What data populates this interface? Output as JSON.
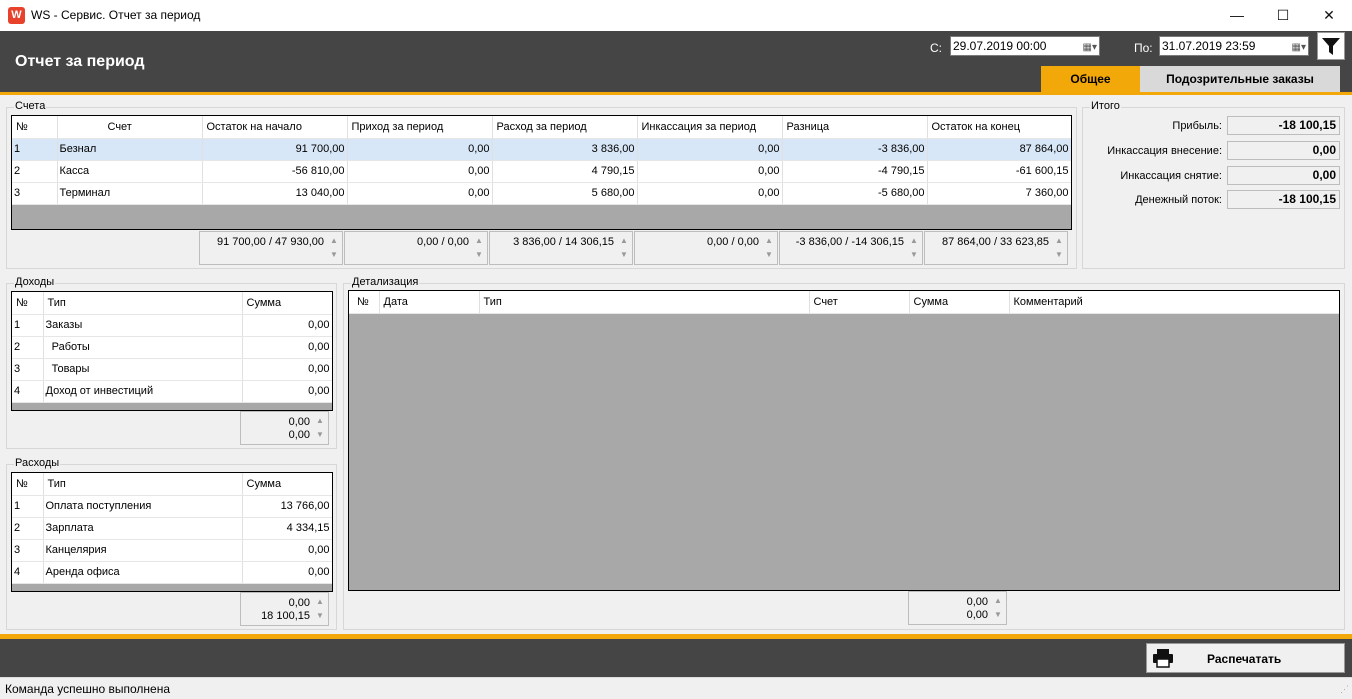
{
  "window": {
    "title": "WS - Сервис. Отчет за период",
    "icon_text": "W"
  },
  "header": {
    "title": "Отчет за период",
    "from_label": "С:",
    "from_value": "29.07.2019 00:00",
    "to_label": "По:",
    "to_value": "31.07.2019 23:59",
    "tabs": [
      {
        "label": "Общее",
        "active": true
      },
      {
        "label": "Подозрительные заказы",
        "active": false
      }
    ]
  },
  "accounts": {
    "label": "Счета",
    "columns": [
      "№",
      "Счет",
      "Остаток на начало",
      "Приход за период",
      "Расход за период",
      "Инкассация за период",
      "Разница",
      "Остаток на конец"
    ],
    "rows": [
      [
        "1",
        "Безнал",
        "91 700,00",
        "0,00",
        "3 836,00",
        "0,00",
        "-3 836,00",
        "87 864,00"
      ],
      [
        "2",
        "Касса",
        "-56 810,00",
        "0,00",
        "4 790,15",
        "0,00",
        "-4 790,15",
        "-61 600,15"
      ],
      [
        "3",
        "Терминал",
        "13 040,00",
        "0,00",
        "5 680,00",
        "0,00",
        "-5 680,00",
        "7 360,00"
      ]
    ],
    "totals": [
      "91 700,00 / 47 930,00",
      "0,00 / 0,00",
      "3 836,00 / 14 306,15",
      "0,00 / 0,00",
      "-3 836,00 / -14 306,15",
      "87 864,00 / 33 623,85"
    ]
  },
  "summary": {
    "label": "Итого",
    "items": [
      {
        "label": "Прибыль:",
        "value": "-18 100,15"
      },
      {
        "label": "Инкассация внесение:",
        "value": "0,00"
      },
      {
        "label": "Инкассация снятие:",
        "value": "0,00"
      },
      {
        "label": "Денежный поток:",
        "value": "-18 100,15"
      }
    ]
  },
  "income": {
    "label": "Доходы",
    "columns": [
      "№",
      "Тип",
      "Сумма"
    ],
    "rows": [
      [
        "1",
        "Заказы",
        "0,00"
      ],
      [
        "2",
        "  Работы",
        "0,00"
      ],
      [
        "3",
        "  Товары",
        "0,00"
      ],
      [
        "4",
        "Доход от инвестиций",
        "0,00"
      ]
    ],
    "totals": [
      "0,00",
      "0,00"
    ]
  },
  "expenses": {
    "label": "Расходы",
    "columns": [
      "№",
      "Тип",
      "Сумма"
    ],
    "rows": [
      [
        "1",
        "Оплата поступления",
        "13 766,00"
      ],
      [
        "2",
        "Зарплата",
        "4 334,15"
      ],
      [
        "3",
        "Канцелярия",
        "0,00"
      ],
      [
        "4",
        "Аренда офиса",
        "0,00"
      ]
    ],
    "totals": [
      "0,00",
      "18 100,15"
    ]
  },
  "details": {
    "label": "Детализация",
    "columns": [
      "№",
      "Дата",
      "Тип",
      "Счет",
      "Сумма",
      "Комментарий"
    ],
    "totals": [
      "0,00",
      "0,00"
    ]
  },
  "footer": {
    "print_label": "Распечатать"
  },
  "status": {
    "text": "Команда успешно выполнена"
  },
  "colors": {
    "accent": "#f3a80a",
    "header_bg": "#454545",
    "selected_row": "#d8e7f7"
  }
}
